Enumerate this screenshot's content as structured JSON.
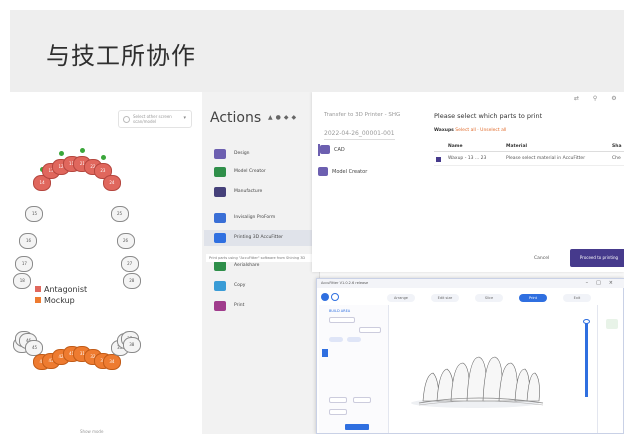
{
  "header": {
    "title": "与技工所协作"
  },
  "dental": {
    "dropdown_text": "Select other screen scan/model",
    "legend": [
      {
        "label": "Antagonist",
        "color": "#e0675d"
      },
      {
        "label": "Mockup",
        "color": "#ee7b30"
      }
    ],
    "footer": "Show mode",
    "upper_left": [
      "18",
      "17",
      "16",
      "15",
      "14",
      "13",
      "12",
      "11"
    ],
    "upper_right": [
      "21",
      "22",
      "23",
      "24",
      "25",
      "26",
      "27",
      "28"
    ],
    "lower_left": [
      "48",
      "47",
      "46",
      "45",
      "44",
      "43",
      "42",
      "41"
    ],
    "lower_right": [
      "31",
      "32",
      "33",
      "34",
      "35",
      "36",
      "37",
      "38"
    ]
  },
  "actions": {
    "title": "Actions",
    "items": [
      {
        "label": "Design",
        "color": "#6c5fb0"
      },
      {
        "label": "Model Creator",
        "color": "#2f8f4a"
      },
      {
        "label": "Manufacture",
        "color": "#46417a"
      },
      {
        "label": "Invisalign ProForm",
        "color": "#3a6fd6"
      },
      {
        "label": "Printing 3D AccuFitter",
        "color": "#2f6fe0"
      },
      {
        "label": "Aerialshare",
        "color": "#2f8f4a"
      },
      {
        "label": "Copy",
        "color": "#3a9cd6"
      },
      {
        "label": "Print",
        "color": "#a03c8c"
      }
    ],
    "tooltip": "Print parts using \"AccuFitter\" software from Shining 3D"
  },
  "dialog": {
    "title": "Transfer to 3D Printer - SHG",
    "case_id": "2022-04-26_00001-001",
    "side_items": [
      "CAD",
      "Model Creator"
    ],
    "question": "Please select which parts to print",
    "filter_label": "Waxups",
    "filter_links": "Select all · Unselect all",
    "columns": [
      "Name",
      "Material",
      "Sha"
    ],
    "row": {
      "name": "Waxup - 13 ... 23",
      "material": "Please select material in AccuFitter",
      "shade": "Che"
    },
    "cancel": "Cancel",
    "proceed": "Proceed to printing"
  },
  "accufitter": {
    "window_title": "AccuFitter V1.0.2.6 release",
    "steps": [
      "Arrange",
      "Edit size",
      "Slice",
      "Print",
      "Exit"
    ],
    "active_step": "Print",
    "section": "BUILD AREA"
  }
}
